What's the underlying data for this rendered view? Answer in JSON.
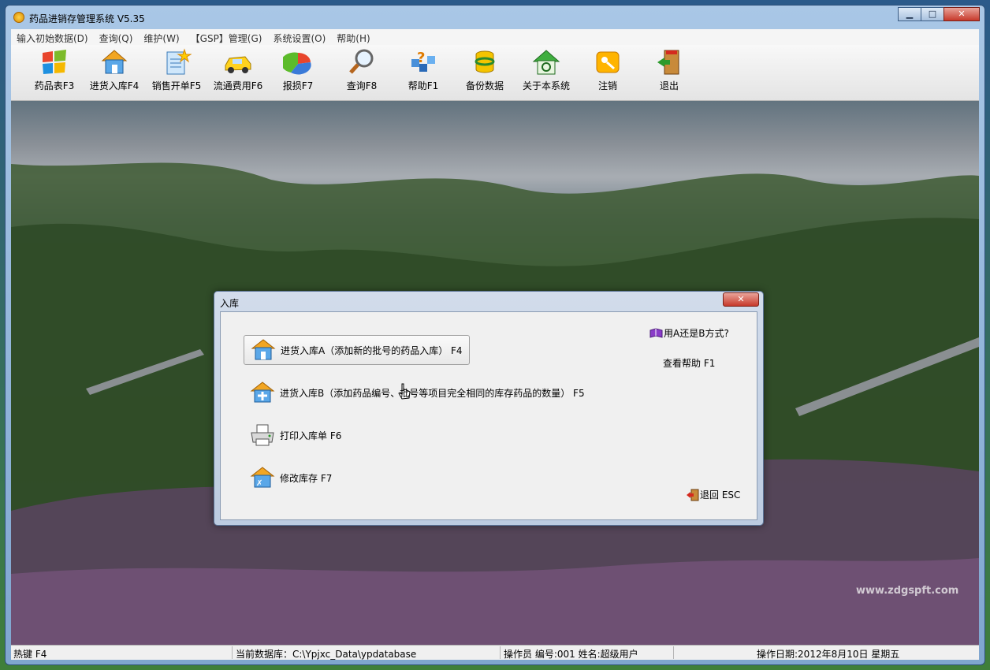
{
  "window": {
    "title": "药品进销存管理系统 V5.35",
    "controls": {
      "minimize": "▁",
      "maximize": "□",
      "close": "✕"
    }
  },
  "menubar": {
    "items": [
      "输入初始数据(D)",
      "查询(Q)",
      "维护(W)",
      "【GSP】管理(G)",
      "系统设置(O)",
      "帮助(H)"
    ]
  },
  "toolbar": {
    "items": [
      {
        "label": "药品表F3",
        "icon": "windows-logo-icon"
      },
      {
        "label": "进货入库F4",
        "icon": "house-icon"
      },
      {
        "label": "销售开单F5",
        "icon": "document-star-icon"
      },
      {
        "label": "流通费用F6",
        "icon": "taxi-icon"
      },
      {
        "label": "报损F7",
        "icon": "pie-chart-icon"
      },
      {
        "label": "查询F8",
        "icon": "magnifier-icon"
      },
      {
        "label": "帮助F1",
        "icon": "help-question-icon"
      },
      {
        "label": "备份数据",
        "icon": "database-icon"
      },
      {
        "label": "关于本系统",
        "icon": "about-house-icon"
      },
      {
        "label": "注销",
        "icon": "key-icon"
      },
      {
        "label": "退出",
        "icon": "exit-door-icon"
      }
    ]
  },
  "dialog": {
    "title": "入库",
    "close": "✕",
    "options": [
      {
        "label": "进货入库A（添加新的批号的药品入库） F4",
        "icon": "house-icon"
      },
      {
        "label": "进货入库B（添加药品编号、批号等项目完全相同的库存药品的数量） F5",
        "icon": "house-plus-icon"
      },
      {
        "label": "打印入库单 F6",
        "icon": "printer-icon"
      },
      {
        "label": "修改库存 F7",
        "icon": "house-edit-icon"
      }
    ],
    "which_method": "用A还是B方式?",
    "help": "查看帮助 F1",
    "back": "退回 ESC"
  },
  "statusbar": {
    "hotkey": "热键 F4",
    "database": "当前数据库：C:\\Ypjxc_Data\\ypdatabase",
    "operator": "操作员 编号:001  姓名:超级用户",
    "date": "操作日期:2012年8月10日 星期五"
  },
  "watermark": "www.zdgspft.com"
}
